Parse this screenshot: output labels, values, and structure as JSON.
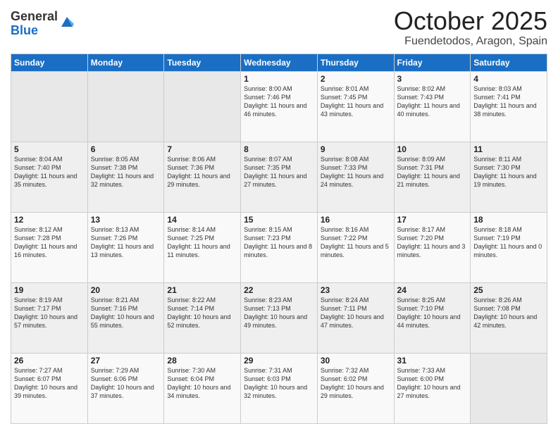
{
  "logo": {
    "general": "General",
    "blue": "Blue"
  },
  "title": "October 2025",
  "subtitle": "Fuendetodos, Aragon, Spain",
  "weekdays": [
    "Sunday",
    "Monday",
    "Tuesday",
    "Wednesday",
    "Thursday",
    "Friday",
    "Saturday"
  ],
  "weeks": [
    [
      {
        "day": "",
        "sunrise": "",
        "sunset": "",
        "daylight": ""
      },
      {
        "day": "",
        "sunrise": "",
        "sunset": "",
        "daylight": ""
      },
      {
        "day": "",
        "sunrise": "",
        "sunset": "",
        "daylight": ""
      },
      {
        "day": "1",
        "sunrise": "Sunrise: 8:00 AM",
        "sunset": "Sunset: 7:46 PM",
        "daylight": "Daylight: 11 hours and 46 minutes."
      },
      {
        "day": "2",
        "sunrise": "Sunrise: 8:01 AM",
        "sunset": "Sunset: 7:45 PM",
        "daylight": "Daylight: 11 hours and 43 minutes."
      },
      {
        "day": "3",
        "sunrise": "Sunrise: 8:02 AM",
        "sunset": "Sunset: 7:43 PM",
        "daylight": "Daylight: 11 hours and 40 minutes."
      },
      {
        "day": "4",
        "sunrise": "Sunrise: 8:03 AM",
        "sunset": "Sunset: 7:41 PM",
        "daylight": "Daylight: 11 hours and 38 minutes."
      }
    ],
    [
      {
        "day": "5",
        "sunrise": "Sunrise: 8:04 AM",
        "sunset": "Sunset: 7:40 PM",
        "daylight": "Daylight: 11 hours and 35 minutes."
      },
      {
        "day": "6",
        "sunrise": "Sunrise: 8:05 AM",
        "sunset": "Sunset: 7:38 PM",
        "daylight": "Daylight: 11 hours and 32 minutes."
      },
      {
        "day": "7",
        "sunrise": "Sunrise: 8:06 AM",
        "sunset": "Sunset: 7:36 PM",
        "daylight": "Daylight: 11 hours and 29 minutes."
      },
      {
        "day": "8",
        "sunrise": "Sunrise: 8:07 AM",
        "sunset": "Sunset: 7:35 PM",
        "daylight": "Daylight: 11 hours and 27 minutes."
      },
      {
        "day": "9",
        "sunrise": "Sunrise: 8:08 AM",
        "sunset": "Sunset: 7:33 PM",
        "daylight": "Daylight: 11 hours and 24 minutes."
      },
      {
        "day": "10",
        "sunrise": "Sunrise: 8:09 AM",
        "sunset": "Sunset: 7:31 PM",
        "daylight": "Daylight: 11 hours and 21 minutes."
      },
      {
        "day": "11",
        "sunrise": "Sunrise: 8:11 AM",
        "sunset": "Sunset: 7:30 PM",
        "daylight": "Daylight: 11 hours and 19 minutes."
      }
    ],
    [
      {
        "day": "12",
        "sunrise": "Sunrise: 8:12 AM",
        "sunset": "Sunset: 7:28 PM",
        "daylight": "Daylight: 11 hours and 16 minutes."
      },
      {
        "day": "13",
        "sunrise": "Sunrise: 8:13 AM",
        "sunset": "Sunset: 7:26 PM",
        "daylight": "Daylight: 11 hours and 13 minutes."
      },
      {
        "day": "14",
        "sunrise": "Sunrise: 8:14 AM",
        "sunset": "Sunset: 7:25 PM",
        "daylight": "Daylight: 11 hours and 11 minutes."
      },
      {
        "day": "15",
        "sunrise": "Sunrise: 8:15 AM",
        "sunset": "Sunset: 7:23 PM",
        "daylight": "Daylight: 11 hours and 8 minutes."
      },
      {
        "day": "16",
        "sunrise": "Sunrise: 8:16 AM",
        "sunset": "Sunset: 7:22 PM",
        "daylight": "Daylight: 11 hours and 5 minutes."
      },
      {
        "day": "17",
        "sunrise": "Sunrise: 8:17 AM",
        "sunset": "Sunset: 7:20 PM",
        "daylight": "Daylight: 11 hours and 3 minutes."
      },
      {
        "day": "18",
        "sunrise": "Sunrise: 8:18 AM",
        "sunset": "Sunset: 7:19 PM",
        "daylight": "Daylight: 11 hours and 0 minutes."
      }
    ],
    [
      {
        "day": "19",
        "sunrise": "Sunrise: 8:19 AM",
        "sunset": "Sunset: 7:17 PM",
        "daylight": "Daylight: 10 hours and 57 minutes."
      },
      {
        "day": "20",
        "sunrise": "Sunrise: 8:21 AM",
        "sunset": "Sunset: 7:16 PM",
        "daylight": "Daylight: 10 hours and 55 minutes."
      },
      {
        "day": "21",
        "sunrise": "Sunrise: 8:22 AM",
        "sunset": "Sunset: 7:14 PM",
        "daylight": "Daylight: 10 hours and 52 minutes."
      },
      {
        "day": "22",
        "sunrise": "Sunrise: 8:23 AM",
        "sunset": "Sunset: 7:13 PM",
        "daylight": "Daylight: 10 hours and 49 minutes."
      },
      {
        "day": "23",
        "sunrise": "Sunrise: 8:24 AM",
        "sunset": "Sunset: 7:11 PM",
        "daylight": "Daylight: 10 hours and 47 minutes."
      },
      {
        "day": "24",
        "sunrise": "Sunrise: 8:25 AM",
        "sunset": "Sunset: 7:10 PM",
        "daylight": "Daylight: 10 hours and 44 minutes."
      },
      {
        "day": "25",
        "sunrise": "Sunrise: 8:26 AM",
        "sunset": "Sunset: 7:08 PM",
        "daylight": "Daylight: 10 hours and 42 minutes."
      }
    ],
    [
      {
        "day": "26",
        "sunrise": "Sunrise: 7:27 AM",
        "sunset": "Sunset: 6:07 PM",
        "daylight": "Daylight: 10 hours and 39 minutes."
      },
      {
        "day": "27",
        "sunrise": "Sunrise: 7:29 AM",
        "sunset": "Sunset: 6:06 PM",
        "daylight": "Daylight: 10 hours and 37 minutes."
      },
      {
        "day": "28",
        "sunrise": "Sunrise: 7:30 AM",
        "sunset": "Sunset: 6:04 PM",
        "daylight": "Daylight: 10 hours and 34 minutes."
      },
      {
        "day": "29",
        "sunrise": "Sunrise: 7:31 AM",
        "sunset": "Sunset: 6:03 PM",
        "daylight": "Daylight: 10 hours and 32 minutes."
      },
      {
        "day": "30",
        "sunrise": "Sunrise: 7:32 AM",
        "sunset": "Sunset: 6:02 PM",
        "daylight": "Daylight: 10 hours and 29 minutes."
      },
      {
        "day": "31",
        "sunrise": "Sunrise: 7:33 AM",
        "sunset": "Sunset: 6:00 PM",
        "daylight": "Daylight: 10 hours and 27 minutes."
      },
      {
        "day": "",
        "sunrise": "",
        "sunset": "",
        "daylight": ""
      }
    ]
  ]
}
